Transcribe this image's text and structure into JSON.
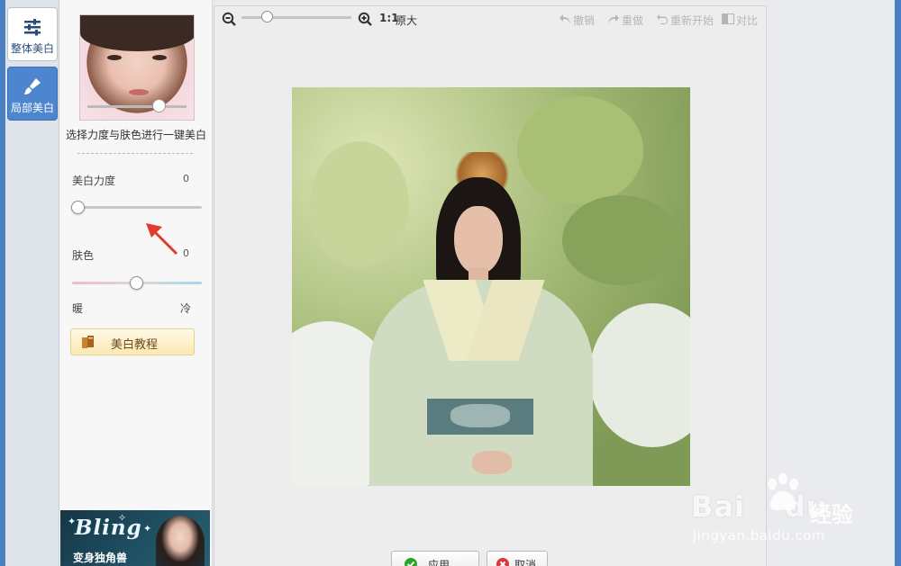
{
  "tabs": [
    {
      "label": "整体美白",
      "active": true,
      "icon": "sliders-icon"
    },
    {
      "label": "局部美白",
      "active": false,
      "icon": "brush-icon"
    }
  ],
  "panel": {
    "description": "选择力度与肤色进行一键美白",
    "whitening_label": "美白力度",
    "whitening_value": "0",
    "whitening_level": 0.0,
    "skin_label": "肤色",
    "skin_value": "0",
    "skin_level": 0.5,
    "warm_label": "暖",
    "cold_label": "冷",
    "tutorial_label": "美白教程"
  },
  "ad": {
    "title": "Bling",
    "subtitle": "变身独角兽"
  },
  "toolbar": {
    "zoom_level": 0.2,
    "ratio_label": "1:1",
    "original_label": "原大",
    "undo_label": "撤销",
    "redo_label": "重做",
    "restart_label": "重新开始",
    "compare_label": "对比"
  },
  "actions": {
    "apply_label": "应用",
    "cancel_label": "取消"
  },
  "watermark": {
    "logo": "Bai",
    "logo_suffix": "du",
    "brand_cn": "经验",
    "url": "jingyan.baidu.com"
  },
  "colors": {
    "accent_blue": "#4d86cf",
    "apply_green": "#2aa52e",
    "cancel_red": "#d93b3b",
    "arrow_red": "#e23a2f"
  }
}
